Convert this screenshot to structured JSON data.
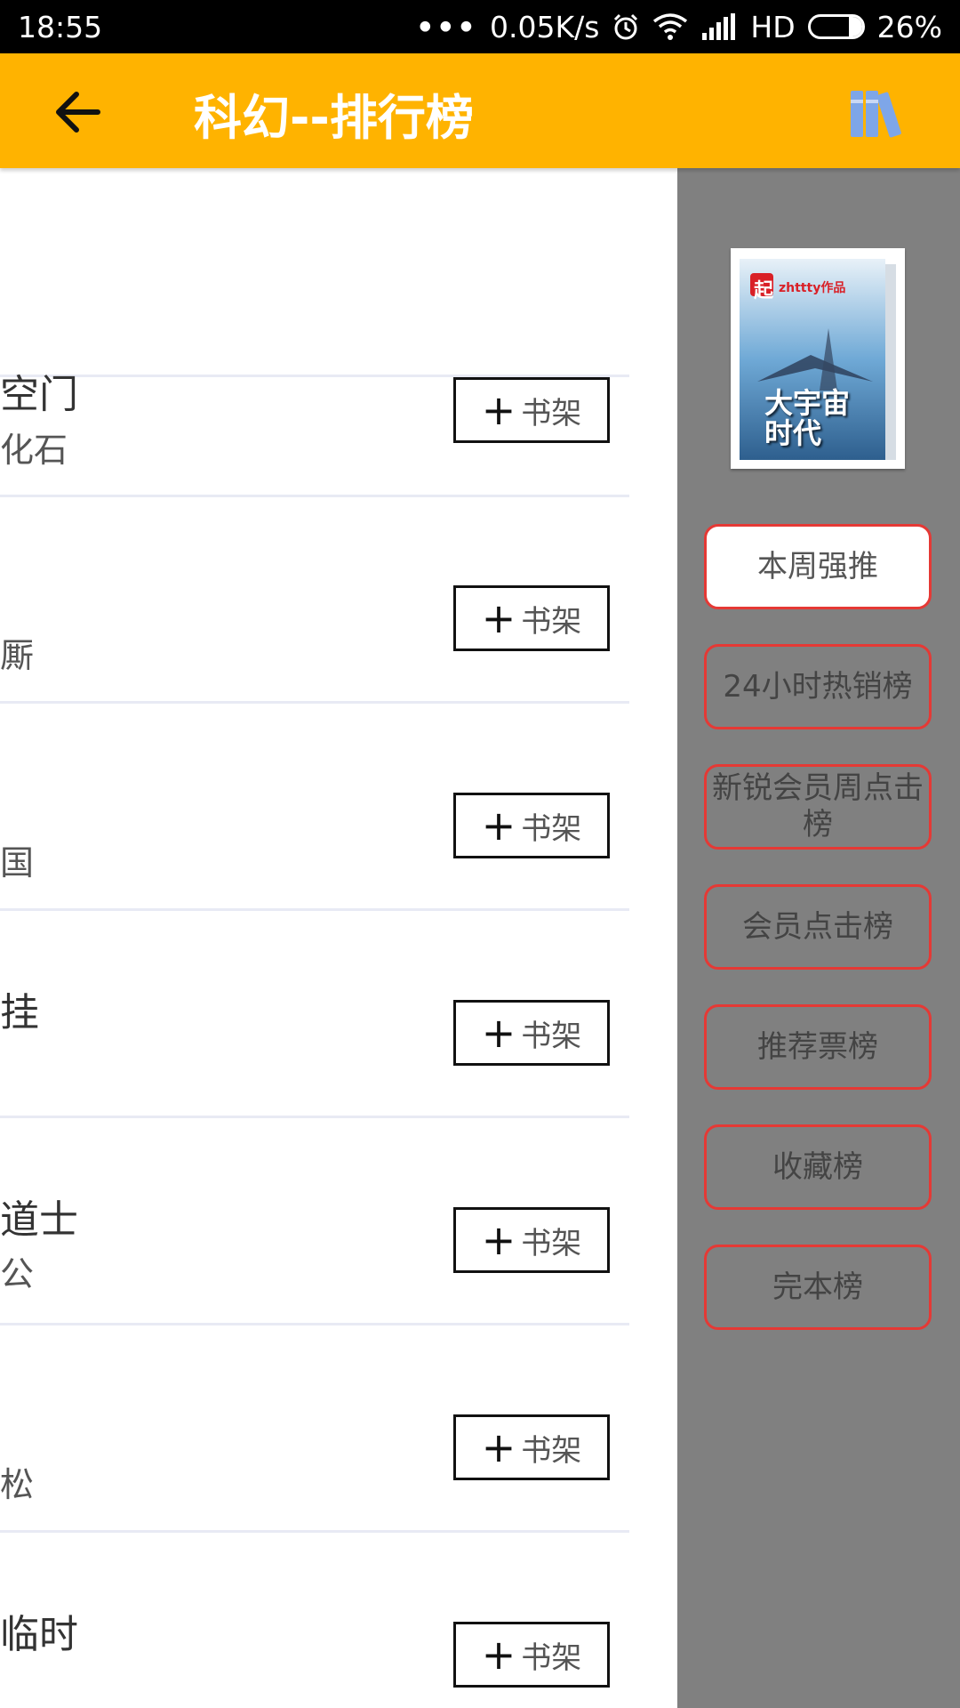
{
  "status_bar": {
    "time": "18:55",
    "dots": "•••",
    "speed": "0.05K/s",
    "hd": "HD",
    "battery": "26%",
    "battery_level": 0.26
  },
  "app_bar": {
    "title": "科幻--排行榜",
    "back_icon": "arrow-left-icon",
    "shelf_icon": "bookshelf-icon",
    "color": "#FFB300"
  },
  "list": {
    "add_button_label": "书架",
    "rows": [
      {
        "name": "空门",
        "sub": "化石"
      },
      {
        "name": "",
        "sub": "厮"
      },
      {
        "name": "",
        "sub": "国"
      },
      {
        "name": "挂",
        "sub": ""
      },
      {
        "name": "道士",
        "sub": "公"
      },
      {
        "name": "",
        "sub": "松"
      },
      {
        "name": "临时",
        "sub": ""
      }
    ]
  },
  "drawer": {
    "cover": {
      "brand": "起",
      "author": "zhttty作品",
      "book_title": "大宇宙时代"
    },
    "rank_lists": [
      {
        "label": "本周强推",
        "active": true
      },
      {
        "label": "24小时热销榜",
        "active": false
      },
      {
        "label": "新锐会员周点击榜",
        "active": false
      },
      {
        "label": "会员点击榜",
        "active": false
      },
      {
        "label": "推荐票榜",
        "active": false
      },
      {
        "label": "收藏榜",
        "active": false
      },
      {
        "label": "完本榜",
        "active": false
      }
    ],
    "accent": "#e53935",
    "background": "#808080"
  }
}
